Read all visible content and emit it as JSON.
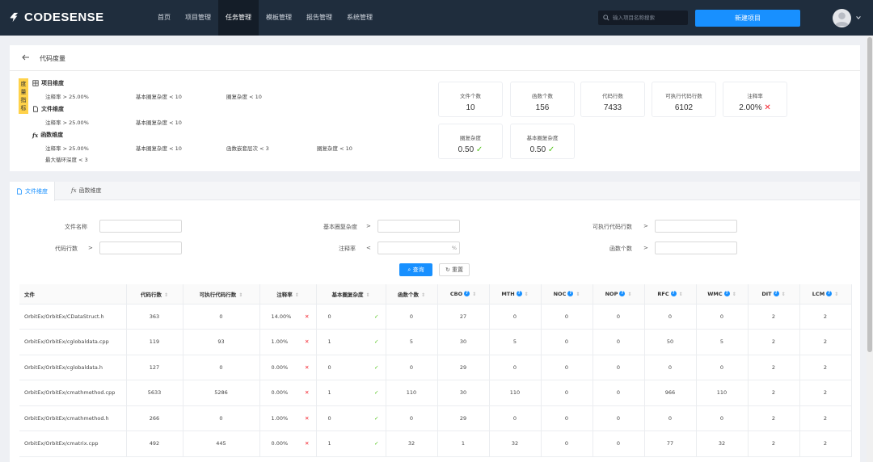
{
  "brand": {
    "name": "CODESENSE"
  },
  "nav": [
    "首页",
    "项目管理",
    "任务管理",
    "模板管理",
    "报告管理",
    "系统管理"
  ],
  "nav_active_index": 2,
  "search": {
    "placeholder": "输入项目名称搜索"
  },
  "new_project_label": "新建项目",
  "page_title": "代码度量",
  "metric_tag": "度量指标",
  "groups": {
    "project": {
      "title": "项目维度",
      "conds": [
        "注释率 > 25.00%",
        "基本圈复杂度 < 10",
        "圈复杂度 < 10"
      ]
    },
    "file": {
      "title": "文件维度",
      "conds": [
        "注释率 > 25.00%",
        "基本圈复杂度 < 10"
      ]
    },
    "function": {
      "title": "函数维度",
      "conds": [
        "注释率 > 25.00%",
        "基本圈复杂度 < 10",
        "函数嵌套层次 < 3",
        "圈复杂度 < 10",
        "最大循环深度 < 3"
      ]
    }
  },
  "stats": [
    {
      "label": "文件个数",
      "value": "10"
    },
    {
      "label": "函数个数",
      "value": "156"
    },
    {
      "label": "代码行数",
      "value": "7433"
    },
    {
      "label": "可执行代码行数",
      "value": "6102"
    },
    {
      "label": "注释率",
      "value": "2.00%"
    },
    {
      "label": "圈复杂度",
      "value": "0.50"
    },
    {
      "label": "基本圈复杂度",
      "value": "0.50"
    }
  ],
  "tabs": [
    "文件维度",
    "函数维度"
  ],
  "filters": {
    "file_name": "文件名称",
    "basic_complexity": "基本圈复杂度",
    "exec_lines": "可执行代码行数",
    "code_lines": "代码行数",
    "comment_rate": "注释率",
    "func_count": "函数个数",
    "op_gt": ">",
    "op_lt": "<",
    "pct": "%"
  },
  "query_label": "查询",
  "reset_label": "重置",
  "table": {
    "headers": [
      "文件",
      "代码行数",
      "可执行代码行数",
      "注释率",
      "基本圈复杂度",
      "函数个数",
      "CBO",
      "MTH",
      "NOC",
      "NOP",
      "RFC",
      "WMC",
      "DIT",
      "LCM"
    ],
    "rows": [
      [
        "OrbitEx/OrbitEx/CDataStruct.h",
        "363",
        "0",
        "14.00%",
        "0",
        "0",
        "27",
        "0",
        "0",
        "0",
        "0",
        "0",
        "2",
        "2"
      ],
      [
        "OrbitEx/OrbitEx/cglobaldata.cpp",
        "119",
        "93",
        "1.00%",
        "1",
        "5",
        "30",
        "5",
        "0",
        "0",
        "50",
        "5",
        "2",
        "2"
      ],
      [
        "OrbitEx/OrbitEx/cglobaldata.h",
        "127",
        "0",
        "0.00%",
        "0",
        "0",
        "29",
        "0",
        "0",
        "0",
        "0",
        "0",
        "2",
        "2"
      ],
      [
        "OrbitEx/OrbitEx/cmathmethod.cpp",
        "5633",
        "5286",
        "0.00%",
        "1",
        "110",
        "30",
        "110",
        "0",
        "0",
        "966",
        "110",
        "2",
        "2"
      ],
      [
        "OrbitEx/OrbitEx/cmathmethod.h",
        "266",
        "0",
        "1.00%",
        "0",
        "0",
        "29",
        "0",
        "0",
        "0",
        "0",
        "0",
        "2",
        "2"
      ],
      [
        "OrbitEx/OrbitEx/cmatrix.cpp",
        "492",
        "445",
        "0.00%",
        "1",
        "32",
        "1",
        "32",
        "0",
        "0",
        "77",
        "32",
        "2",
        "2"
      ]
    ]
  },
  "colors": {
    "topbar": "#1f2d3d",
    "accent": "#1890ff",
    "ok": "#52c41a",
    "bad": "#f5222d",
    "tag": "#ffd24a"
  }
}
